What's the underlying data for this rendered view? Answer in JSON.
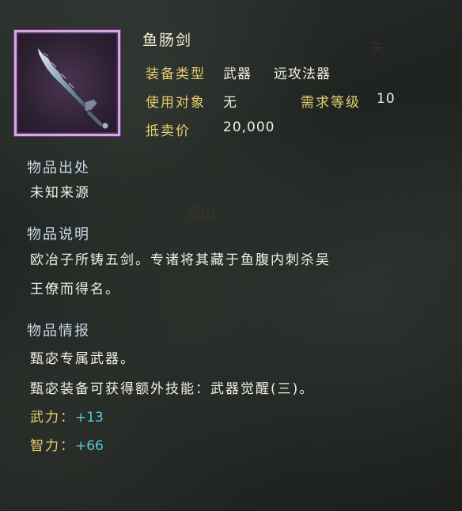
{
  "item": {
    "name": "鱼肠剑",
    "equip_type_label": "装备类型",
    "equip_type_value": "武器",
    "equip_subtype_value": "远攻法器",
    "user_label": "使用对象",
    "user_value": "无",
    "req_level_label": "需求等级",
    "req_level_value": "10",
    "sell_price_label": "抵卖价",
    "sell_price_value": "20,000"
  },
  "origin": {
    "title": "物品出处",
    "text": "未知来源"
  },
  "description": {
    "title": "物品说明",
    "line1": "欧冶子所铸五剑。专诸将其藏于鱼腹内刺杀吴",
    "line2": "王僚而得名。"
  },
  "info": {
    "title": "物品情报",
    "line1": "甄宓专属武器。",
    "line2": "甄宓装备可获得额外技能：武器觉醒(三)。"
  },
  "stats": [
    {
      "label": "武力：",
      "value": "+13"
    },
    {
      "label": "智力：",
      "value": "+66"
    }
  ],
  "background_text": {
    "stamp1": "祁山",
    "stamp2": "天"
  },
  "colors": {
    "gold_label": "#e8cf72",
    "stat_cyan": "#5bc7d6",
    "section_title": "#c7d8e6",
    "frame_purple": "#d7a6e6"
  }
}
